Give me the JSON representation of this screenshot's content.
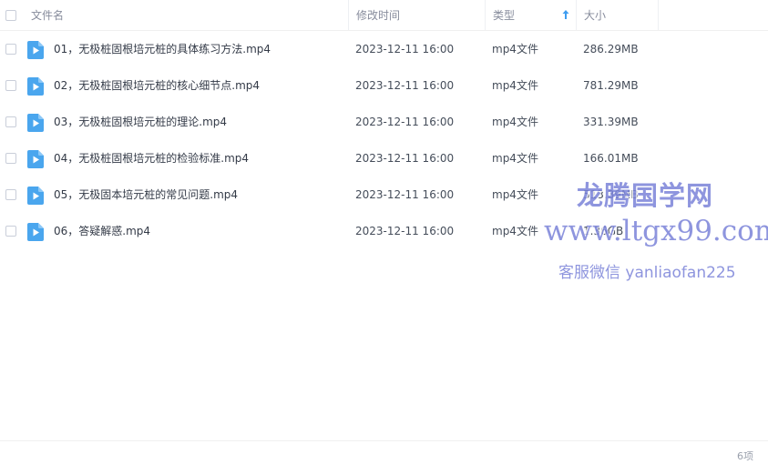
{
  "header": {
    "name": "文件名",
    "modified": "修改时间",
    "type": "类型",
    "size": "大小"
  },
  "files": [
    {
      "name": "01，无极桩固根培元桩的具体练习方法.mp4",
      "time": "2023-12-11 16:00",
      "type": "mp4文件",
      "size": "286.29MB"
    },
    {
      "name": "02，无极桩固根培元桩的核心细节点.mp4",
      "time": "2023-12-11 16:00",
      "type": "mp4文件",
      "size": "781.29MB"
    },
    {
      "name": "03，无极桩固根培元桩的理论.mp4",
      "time": "2023-12-11 16:00",
      "type": "mp4文件",
      "size": "331.39MB"
    },
    {
      "name": "04，无极桩固根培元桩的检验标准.mp4",
      "time": "2023-12-11 16:00",
      "type": "mp4文件",
      "size": "166.01MB"
    },
    {
      "name": "05，无极固本培元桩的常见问题.mp4",
      "time": "2023-12-11 16:00",
      "type": "mp4文件",
      "size": "513.39MB"
    },
    {
      "name": "06，答疑解惑.mp4",
      "time": "2023-12-11 16:00",
      "type": "mp4文件",
      "size": "1.36GB"
    }
  ],
  "watermark": {
    "line1": "龙腾国学网",
    "line2": "www.ltgx99.com",
    "line3": "客服微信 yanliaofan225"
  },
  "footer": {
    "count": "6项"
  },
  "colors": {
    "accent": "#3d9cf0",
    "file_icon": "#4aa6ee"
  }
}
